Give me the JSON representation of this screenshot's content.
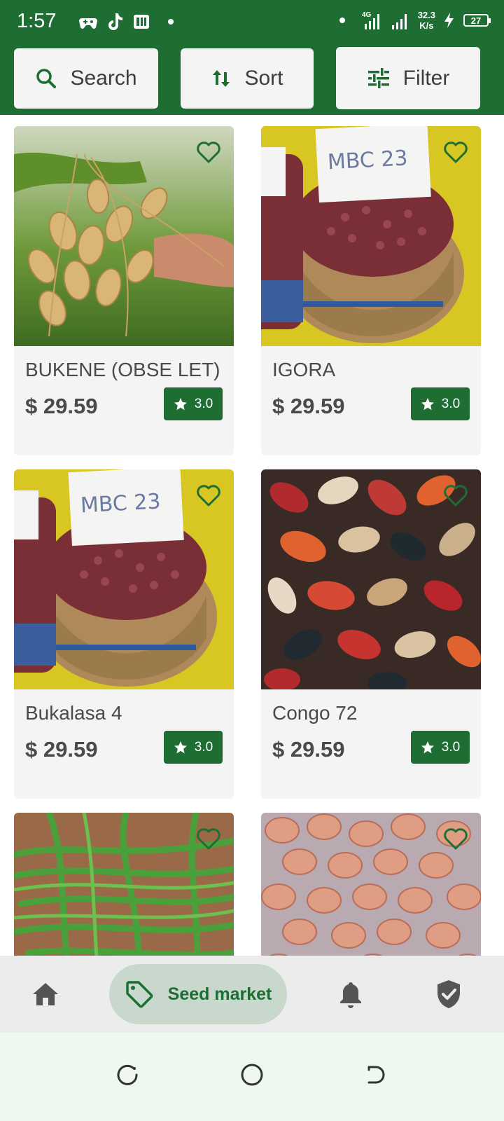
{
  "status_bar": {
    "time": "1:57",
    "network_type": "4G",
    "net_speed_value": "32.3",
    "net_speed_unit": "K/s",
    "battery": "27"
  },
  "toolbar": {
    "search_label": "Search",
    "sort_label": "Sort",
    "filter_label": "Filter"
  },
  "products": [
    {
      "name": "BUKENE (OBSE LET)",
      "price": "$ 29.59",
      "rating": "3.0",
      "image": "peanut-plant-photo"
    },
    {
      "name": "IGORA",
      "price": "$ 29.59",
      "rating": "3.0",
      "image": "red-beans-basket-photo"
    },
    {
      "name": "Bukalasa 4",
      "price": "$ 29.59",
      "rating": "3.0",
      "image": "red-beans-basket-photo"
    },
    {
      "name": "Congo 72",
      "price": "$ 29.59",
      "rating": "3.0",
      "image": "mixed-beans-photo"
    },
    {
      "name": "",
      "price": "",
      "rating": "",
      "image": "green-beans-photo"
    },
    {
      "name": "",
      "price": "",
      "rating": "",
      "image": "peanuts-photo"
    }
  ],
  "bottom_nav": {
    "active_label": "Seed market",
    "items": [
      "home-icon",
      "tag-icon",
      "bell-icon",
      "shield-check-icon"
    ]
  },
  "colors": {
    "brand_green": "#1e6e34",
    "active_pill": "#c9d8cc",
    "card_bg": "#f4f4f4"
  }
}
